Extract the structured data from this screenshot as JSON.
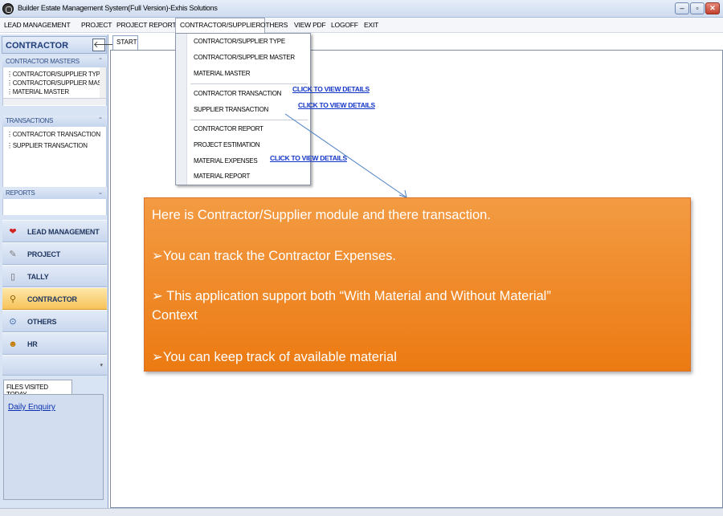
{
  "window": {
    "title": "Builder Estate Management System(Full Version)-Exhis Solutions",
    "min": "–",
    "max": "▫",
    "close": "✕"
  },
  "menu": [
    "LEAD MANAGEMENT",
    "PROJECT",
    "PROJECT REPORTS",
    "CONTRACTOR/SUPPLIER",
    "OTHERS",
    "VIEW PDF",
    "LOGOFF",
    "EXIT"
  ],
  "sidebar": {
    "title": "CONTRACTOR",
    "back": "🡐",
    "masters_header": "CONTRACTOR MASTERS",
    "masters_items": [
      "CONTRACTOR/SUPPLIER TYPE",
      "CONTRACTOR/SUPPLIER MASTER",
      "MATERIAL MASTER"
    ],
    "transactions_header": "TRANSACTIONS",
    "transactions_items": [
      "CONTRACTOR TRANSACTION",
      "SUPPLIER TRANSACTION"
    ],
    "reports_header": "REPORTS",
    "nav": [
      {
        "label": "LEAD MANAGEMENT",
        "icon": "❤",
        "color": "#d42020"
      },
      {
        "label": "PROJECT",
        "icon": "✎",
        "color": "#7a7a7a"
      },
      {
        "label": "TALLY",
        "icon": "▯",
        "color": "#666666"
      },
      {
        "label": "CONTRACTOR",
        "icon": "⚲",
        "color": "#8a5a00"
      },
      {
        "label": "OTHERS",
        "icon": "⊙",
        "color": "#2b5fb0"
      },
      {
        "label": "HR",
        "icon": "☻",
        "color": "#c47a00"
      }
    ]
  },
  "files_visited": {
    "tab": "FILES VISITED TODAY",
    "items": [
      "Daily Enquiry"
    ]
  },
  "tabs": [
    "START"
  ],
  "dropdown": {
    "items": [
      "CONTRACTOR/SUPPLIER TYPE",
      "CONTRACTOR/SUPPLIER MASTER",
      "MATERIAL MASTER",
      "CONTRACTOR TRANSACTION",
      "SUPPLIER TRANSACTION",
      "CONTRACTOR REPORT",
      "PROJECT ESTIMATION",
      "MATERIAL EXPENSES",
      "MATERIAL REPORT"
    ]
  },
  "detail_links": [
    "CLICK TO VIEW DETAILS",
    "CLICK TO VIEW DETAILS",
    "CLICK TO VIEW DETAILS"
  ],
  "callout": {
    "line1": "Here  is Contractor/Supplier module and there transaction.",
    "line2": "➢You can track the Contractor Expenses.",
    "line3": "➢ This application support both “With Material and Without Material”",
    "line4": "Context",
    "line5": "➢You can keep track of available material",
    "color": "#ef8526"
  },
  "colors": {
    "accent": "#1f3d7a",
    "active_nav": "#f7c35a",
    "link": "#1335c7"
  }
}
